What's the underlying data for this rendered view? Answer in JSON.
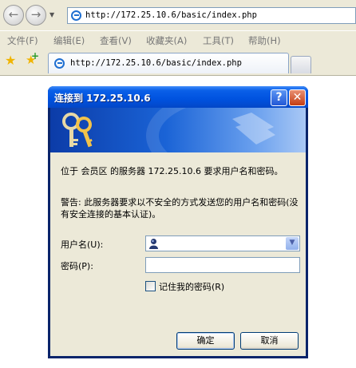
{
  "browser": {
    "address_url": "http://172.25.10.6/basic/index.php",
    "tab_title": "http://172.25.10.6/basic/index.php",
    "menu": [
      "文件(F)",
      "编辑(E)",
      "查看(V)",
      "收藏夹(A)",
      "工具(T)",
      "帮助(H)"
    ]
  },
  "dialog": {
    "title": "连接到 172.25.10.6",
    "help": "?",
    "close": "✕",
    "message": "位于 会员区 的服务器 172.25.10.6 要求用户名和密码。",
    "warning": "警告: 此服务器要求以不安全的方式发送您的用户名和密码(没有安全连接的基本认证)。",
    "username_label": "用户名(U):",
    "username_value": "",
    "password_label": "密码(P):",
    "password_value": "",
    "remember_label": "记住我的密码(R)",
    "remember_checked": false,
    "ok_label": "确定",
    "cancel_label": "取消"
  },
  "colors": {
    "titlebar": "#0054E3",
    "dialog_bg": "#ECE9D8",
    "input_border": "#7F9DB9"
  }
}
